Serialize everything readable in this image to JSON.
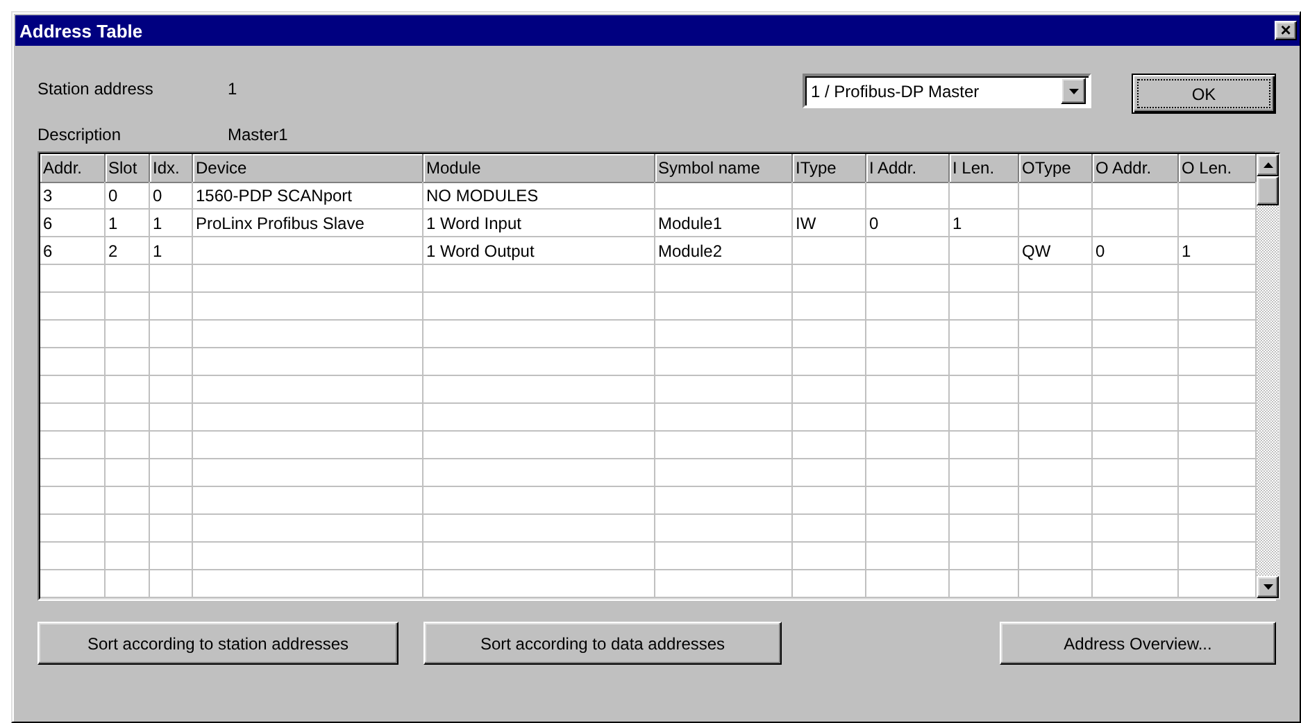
{
  "window": {
    "title": "Address Table",
    "close": "×"
  },
  "station_address": {
    "label": "Station address",
    "value": "1"
  },
  "description": {
    "label": "Description",
    "value": "Master1"
  },
  "master_select": {
    "value": "1 / Profibus-DP Master"
  },
  "ok_button": "OK",
  "table": {
    "columns": [
      "Addr.",
      "Slot",
      "Idx.",
      "Device",
      "Module",
      "Symbol name",
      "IType",
      "I Addr.",
      "I Len.",
      "OType",
      "O Addr.",
      "O Len."
    ],
    "rows": [
      [
        "3",
        "0",
        "0",
        "1560-PDP SCANport",
        "NO MODULES",
        "",
        "",
        "",
        "",
        "",
        "",
        ""
      ],
      [
        "6",
        "1",
        "1",
        "ProLinx Profibus Slave",
        "1 Word Input",
        "Module1",
        "IW",
        "0",
        "1",
        "",
        "",
        ""
      ],
      [
        "6",
        "2",
        "1",
        "",
        "1 Word Output",
        "Module2",
        "",
        "",
        "",
        "QW",
        "0",
        "1"
      ]
    ]
  },
  "buttons": [
    "Sort according to station addresses",
    "Sort according to data addresses",
    "Address Overview..."
  ]
}
